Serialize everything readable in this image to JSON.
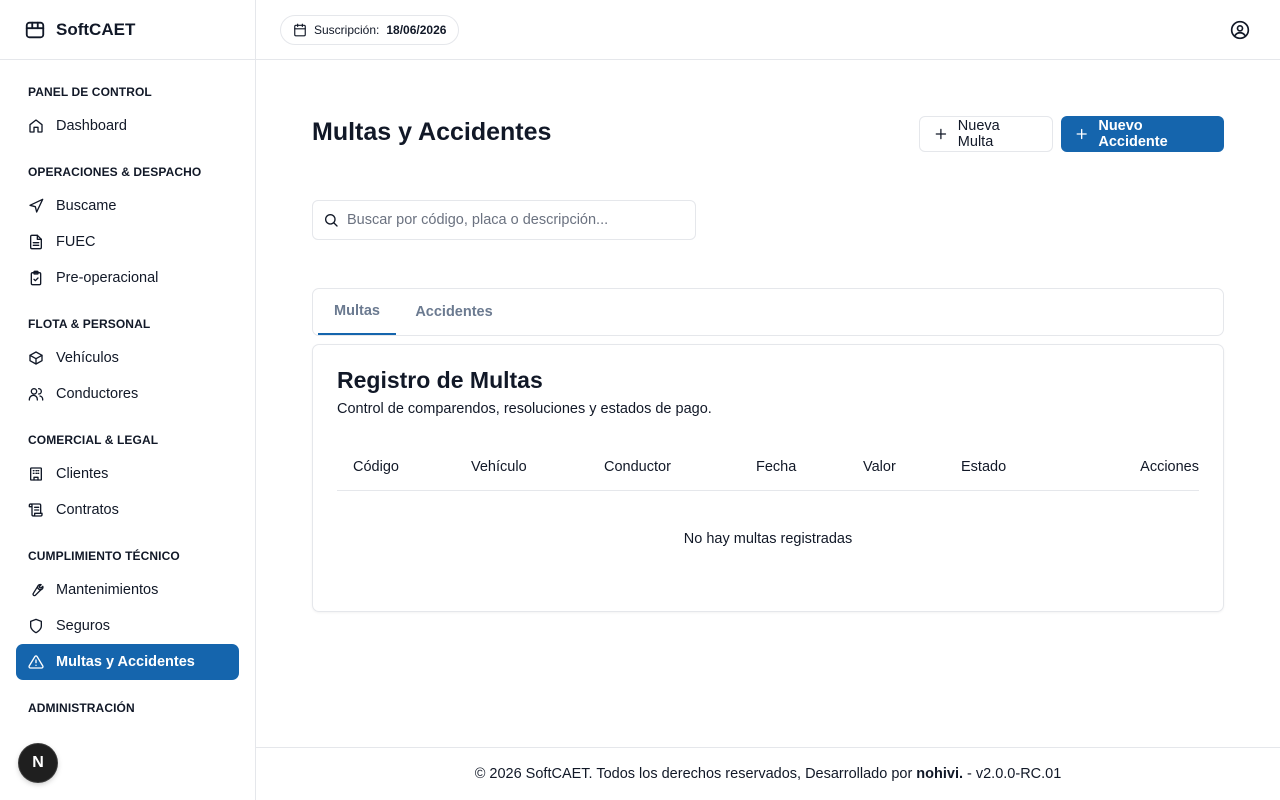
{
  "app": {
    "name": "SoftCAET",
    "logo_icon": "package-icon"
  },
  "subscription": {
    "label": "Suscripción:",
    "date": "18/06/2026"
  },
  "sidebar": {
    "sections": [
      {
        "title": "PANEL DE CONTROL",
        "items": [
          {
            "label": "Dashboard",
            "icon": "home-icon"
          }
        ]
      },
      {
        "title": "OPERACIONES & DESPACHO",
        "items": [
          {
            "label": "Buscame",
            "icon": "navigation-icon"
          },
          {
            "label": "FUEC",
            "icon": "file-text-icon"
          },
          {
            "label": "Pre-operacional",
            "icon": "clipboard-check-icon"
          }
        ]
      },
      {
        "title": "FLOTA & PERSONAL",
        "items": [
          {
            "label": "Vehículos",
            "icon": "box-icon"
          },
          {
            "label": "Conductores",
            "icon": "users-icon"
          }
        ]
      },
      {
        "title": "COMERCIAL & LEGAL",
        "items": [
          {
            "label": "Clientes",
            "icon": "building-icon"
          },
          {
            "label": "Contratos",
            "icon": "scroll-icon"
          }
        ]
      },
      {
        "title": "CUMPLIMIENTO TÉCNICO",
        "items": [
          {
            "label": "Mantenimientos",
            "icon": "wrench-icon"
          },
          {
            "label": "Seguros",
            "icon": "shield-icon"
          },
          {
            "label": "Multas y Accidentes",
            "icon": "alert-triangle-icon",
            "active": true
          }
        ]
      },
      {
        "title": "ADMINISTRACIÓN",
        "items": []
      }
    ],
    "avatar_letter": "N"
  },
  "main": {
    "title": "Multas y Accidentes",
    "buttons": {
      "new_fine": "Nueva Multa",
      "new_accident": "Nuevo Accidente"
    },
    "search": {
      "placeholder": "Buscar por código, placa o descripción...",
      "value": ""
    },
    "tabs": [
      {
        "label": "Multas",
        "active": true
      },
      {
        "label": "Accidentes",
        "active": false
      }
    ],
    "card": {
      "title": "Registro de Multas",
      "description": "Control de comparendos, resoluciones y estados de pago.",
      "columns": [
        "Código",
        "Vehículo",
        "Conductor",
        "Fecha",
        "Valor",
        "Estado",
        "Acciones"
      ],
      "empty_text": "No hay multas registradas"
    }
  },
  "footer": {
    "prefix": "© 2026 SoftCAET. Todos los derechos reservados, Desarrollado por",
    "developer": "nohivi.",
    "version": "- v2.0.0-RC.01"
  },
  "colors": {
    "accent": "#1565ad",
    "border": "#e5e7eb",
    "text": "#111827",
    "muted_tab": "#6b7a90"
  }
}
